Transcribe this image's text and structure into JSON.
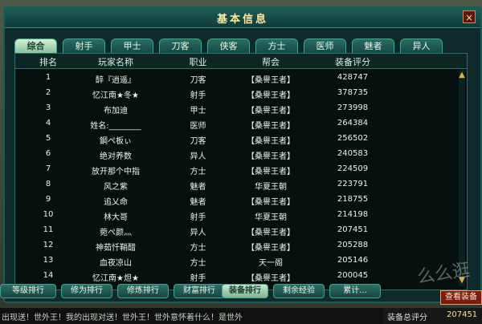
{
  "window": {
    "title": "基本信息",
    "close_icon": "close-icon"
  },
  "tabs": [
    "综合",
    "射手",
    "甲士",
    "刀客",
    "侠客",
    "方士",
    "医师",
    "魅者",
    "异人"
  ],
  "table": {
    "headers": [
      "排名",
      "玩家名称",
      "职业",
      "帮会",
      "装备评分"
    ],
    "rows": [
      {
        "rank": "1",
        "name": "醉『逍遥』",
        "job": "刀客",
        "guild": "【桑譽王者】",
        "score": "428747"
      },
      {
        "rank": "2",
        "name": "忆江南★冬★",
        "job": "射手",
        "guild": "【桑譽王者】",
        "score": "378735"
      },
      {
        "rank": "3",
        "name": "布加迪",
        "job": "甲士",
        "guild": "【桑譽王者】",
        "score": "273998"
      },
      {
        "rank": "4",
        "name": "姓名:________",
        "job": "医师",
        "guild": "【桑譽王者】",
        "score": "264384"
      },
      {
        "rank": "5",
        "name": "鋼ぺ板ぃ",
        "job": "刀客",
        "guild": "【桑譽王者】",
        "score": "256502"
      },
      {
        "rank": "6",
        "name": "绝对养数",
        "job": "异人",
        "guild": "【桑譽王者】",
        "score": "240583"
      },
      {
        "rank": "7",
        "name": "放开那个中指",
        "job": "方士",
        "guild": "【桑譽王者】",
        "score": "224509"
      },
      {
        "rank": "8",
        "name": "风之紫",
        "job": "魅者",
        "guild": "华夏王朝",
        "score": "223791"
      },
      {
        "rank": "9",
        "name": "追乂命",
        "job": "魅者",
        "guild": "【桑譽王者】",
        "score": "218755"
      },
      {
        "rank": "10",
        "name": "林大哥",
        "job": "射手",
        "guild": "华夏王朝",
        "score": "214198"
      },
      {
        "rank": "11",
        "name": "菀ぺ颜灬",
        "job": "异人",
        "guild": "【桑譽王者】",
        "score": "207451"
      },
      {
        "rank": "12",
        "name": "神茹忏鞘醋",
        "job": "方士",
        "guild": "【桑譽王者】",
        "score": "205288"
      },
      {
        "rank": "13",
        "name": "血夜凉山",
        "job": "方士",
        "guild": "天一阁",
        "score": "205146"
      },
      {
        "rank": "14",
        "name": "忆江南★炟★",
        "job": "射手",
        "guild": "【桑譽王者】",
        "score": "200045"
      }
    ]
  },
  "bottom_tabs": [
    "等级排行",
    "修为排行",
    "修炼排行",
    "财富排行",
    "装备排行",
    "剩余经验",
    "累计..."
  ],
  "view_button": "查看装备",
  "chat": "出现送！世外王！我的出现对送！世外王！世外意怀着什么！是世外",
  "footer": {
    "label": "装备总评分",
    "value": "207451"
  },
  "watermark": "么么逛"
}
